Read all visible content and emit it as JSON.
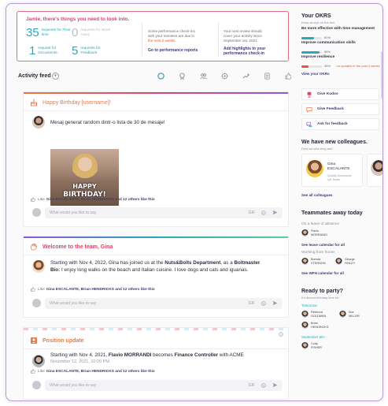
{
  "todo": {
    "title": "Jamie, there's things you need to look into.",
    "metrics": [
      {
        "num": "35",
        "label": "requests for Flexi time"
      },
      {
        "num": "0",
        "label": "requests for Work Away"
      },
      {
        "num": "1",
        "label": "request for Documents"
      },
      {
        "num": "5",
        "label": "requests for Feedback"
      }
    ],
    "perf_text_1": "Some performance check-ins",
    "perf_text_2": "with your mentees are due in",
    "perf_text_warn": "the next 2 weeks.",
    "perf_link": "Go to performance reports",
    "review_text_1": "Your next review should",
    "review_text_2": "cover your activity since",
    "review_text_3": "September 1st, 2021",
    "review_link_1": "Add highlights to your",
    "review_link_2": "performance check-in"
  },
  "feed": {
    "title": "Activity feed",
    "plus": "+",
    "filters": [
      "all-filter-icon",
      "award-filter-icon",
      "people-filter-icon",
      "target-filter-icon",
      "trend-filter-icon",
      "doc-filter-icon",
      "like-filter-icon"
    ]
  },
  "posts": {
    "birthday": {
      "title": "Happy Birthday [username]!",
      "message": "Mesaj generat random dintr-o lista de 30 de mesaje!",
      "gif_line1": "HAPPY",
      "gif_line2": "BIRTHDAY!",
      "like_label": "Like",
      "likers": "Gina ESCALANTE, Brian HENDRICKS and 12 others like this",
      "comment_placeholder": "What would you like to say",
      "gif_btn": "GIF"
    },
    "welcome": {
      "title": "Welcome to the team, Gina",
      "msg_a": "Starting with Nov 4, 2022, Gina has joined us at the ",
      "msg_dept": "Nuts&Bolts Department",
      "msg_b": ", as a ",
      "msg_role": "Boltmaster",
      "bio_label": "Bio:",
      "bio": " I enjoy long walks on the beach and Italian cuisine. I love dogs and cats and iguanas.",
      "like_label": "Like",
      "likers": "Gina ESCALANTE, Brian HENDRICKS and 12 others like this",
      "comment_placeholder": "What would you like to say",
      "gif_btn": "GIF"
    },
    "position": {
      "title": "Position update",
      "msg_a": "Starting with Nov 4, 2021, ",
      "msg_name": "Flavio MORRANDI",
      "msg_b": " becomes ",
      "msg_role": "Finance Controller",
      "msg_c": " with ACME",
      "date": "November 12, 2021, 10:00 PM",
      "like_label": "Like",
      "likers": "Gina ESCALANTE, Brian HENDRICKS and 12 others like this",
      "comment_placeholder": "What would you like to say",
      "gif_btn": "GIF"
    }
  },
  "right": {
    "okrs_title": "Your OKRS",
    "okrs_sub": "Keep an eye on the fun!",
    "okrs": [
      {
        "title": "Be more effective with time management",
        "pct": "60%",
        "value": 0.6,
        "warn": ""
      },
      {
        "title": "Improve communication skills",
        "pct": "88%",
        "value": 0.88,
        "warn": ""
      },
      {
        "title": "Improve resilience",
        "pct": "35%",
        "value": 0.35,
        "warn": "no updates in the past 2 weeks"
      }
    ],
    "view_okrs": "View your OKRs",
    "actions": [
      {
        "label": "Give Kudos",
        "icon": "kudos-icon"
      },
      {
        "label": "Give Feedback",
        "icon": "feedback-icon"
      },
      {
        "label": "Ask for feedback",
        "icon": "ask-feedback-icon"
      }
    ],
    "new_colleagues_title": "We have new colleagues.",
    "new_colleagues_sub": "Find out who they are!",
    "colleague_name_1": "Gina",
    "colleague_name_2": "ESCALANTE",
    "colleague_role_1": "Quality Assurance",
    "colleague_role_2": "QA Tester",
    "see_colleagues": "See all colleagues",
    "away_title": "Teammates away today",
    "leave_group": "On a leave of absence",
    "leave_person_1": "Flavio",
    "leave_person_2": "MORRANDI",
    "see_leave": "See leave calendar for all",
    "home_group": "Working from home:",
    "home_people": [
      {
        "first": "Brenda",
        "last": "STERNON"
      },
      {
        "first": "George",
        "last": "FINLEY"
      }
    ],
    "see_wfh": "See WFH calendar for all",
    "party_title": "Ready to party?",
    "party_sub": "It's almost birthday time for:",
    "tomorrow": "Tomorrow:",
    "tomorrow_people": [
      {
        "first": "Rebecca",
        "last": "GOLDMAN"
      },
      {
        "first": "Ava",
        "last": "MILLER"
      },
      {
        "first": "Brian",
        "last": "HENDRICKS"
      }
    ],
    "september": "September 6th:",
    "september_people": [
      {
        "first": "Cody",
        "last": "FISHER"
      }
    ]
  },
  "colors": {
    "accent_pink": "#d9466a",
    "accent_teal": "#2aa8b8",
    "accent_orange": "#e8794a",
    "link_navy": "#3d3b7a"
  }
}
